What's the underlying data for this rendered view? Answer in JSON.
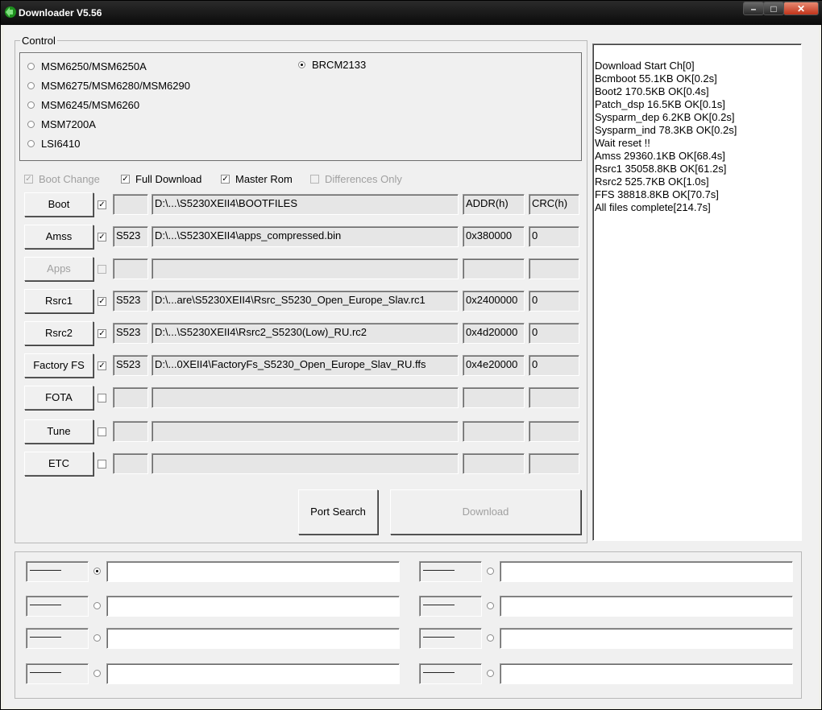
{
  "window": {
    "title": "Downloader V5.56"
  },
  "control": {
    "group_label": "Control",
    "chipsets": [
      {
        "label": "MSM6250/MSM6250A",
        "selected": false
      },
      {
        "label": "MSM6275/MSM6280/MSM6290",
        "selected": false
      },
      {
        "label": "MSM6245/MSM6260",
        "selected": false
      },
      {
        "label": "MSM7200A",
        "selected": false
      },
      {
        "label": "LSI6410",
        "selected": false
      },
      {
        "label": "BRCM2133",
        "selected": true
      }
    ],
    "options": {
      "boot_change": {
        "label": "Boot Change",
        "checked": true,
        "enabled": false
      },
      "full_download": {
        "label": "Full Download",
        "checked": true,
        "enabled": true
      },
      "master_rom": {
        "label": "Master Rom",
        "checked": true,
        "enabled": true
      },
      "differences_only": {
        "label": "Differences Only",
        "checked": false,
        "enabled": false
      }
    },
    "files": [
      {
        "button": "Boot",
        "enabled": true,
        "checked": true,
        "tag": "",
        "path": "D:\\...\\S5230XEII4\\BOOTFILES",
        "addr": "ADDR(h)",
        "crc": "CRC(h)"
      },
      {
        "button": "Amss",
        "enabled": true,
        "checked": true,
        "tag": "S523",
        "path": "D:\\...\\S5230XEII4\\apps_compressed.bin",
        "addr": "0x380000",
        "crc": "0"
      },
      {
        "button": "Apps",
        "enabled": false,
        "checked": false,
        "tag": "",
        "path": "",
        "addr": "",
        "crc": ""
      },
      {
        "button": "Rsrc1",
        "enabled": true,
        "checked": true,
        "tag": "S523",
        "path": "D:\\...are\\S5230XEII4\\Rsrc_S5230_Open_Europe_Slav.rc1",
        "addr": "0x2400000",
        "crc": "0"
      },
      {
        "button": "Rsrc2",
        "enabled": true,
        "checked": true,
        "tag": "S523",
        "path": "D:\\...\\S5230XEII4\\Rsrc2_S5230(Low)_RU.rc2",
        "addr": "0x4d20000",
        "crc": "0"
      },
      {
        "button": "Factory FS",
        "enabled": true,
        "checked": true,
        "tag": "S523",
        "path": "D:\\...0XEII4\\FactoryFs_S5230_Open_Europe_Slav_RU.ffs",
        "addr": "0x4e20000",
        "crc": "0"
      },
      {
        "button": "FOTA",
        "enabled": true,
        "checked": false,
        "tag": "",
        "path": "",
        "addr": "",
        "crc": ""
      },
      {
        "button": "Tune",
        "enabled": true,
        "checked": false,
        "tag": "",
        "path": "",
        "addr": "",
        "crc": ""
      },
      {
        "button": "ETC",
        "enabled": true,
        "checked": false,
        "tag": "",
        "path": "",
        "addr": "",
        "crc": ""
      }
    ],
    "port_search_label": "Port Search",
    "download_label": "Download"
  },
  "log": {
    "lines": [
      "Download Start Ch[0]",
      "Bcmboot 55.1KB OK[0.2s]",
      "Boot2 170.5KB OK[0.4s]",
      "Patch_dsp 16.5KB OK[0.1s]",
      "Sysparm_dep 6.2KB OK[0.2s]",
      "Sysparm_ind 78.3KB OK[0.2s]",
      "Wait reset !!",
      "Amss 29360.1KB OK[68.4s]",
      "Rsrc1 35058.8KB OK[61.2s]",
      "Rsrc2 525.7KB OK[1.0s]",
      "FFS 38818.8KB OK[70.7s]",
      "All files complete[214.7s]"
    ]
  },
  "ports": [
    {
      "label": "———",
      "selected": true,
      "value": ""
    },
    {
      "label": "———",
      "selected": false,
      "value": ""
    },
    {
      "label": "———",
      "selected": false,
      "value": ""
    },
    {
      "label": "———",
      "selected": false,
      "value": ""
    },
    {
      "label": "———",
      "selected": false,
      "value": ""
    },
    {
      "label": "———",
      "selected": false,
      "value": ""
    },
    {
      "label": "———",
      "selected": false,
      "value": ""
    },
    {
      "label": "———",
      "selected": false,
      "value": ""
    }
  ]
}
